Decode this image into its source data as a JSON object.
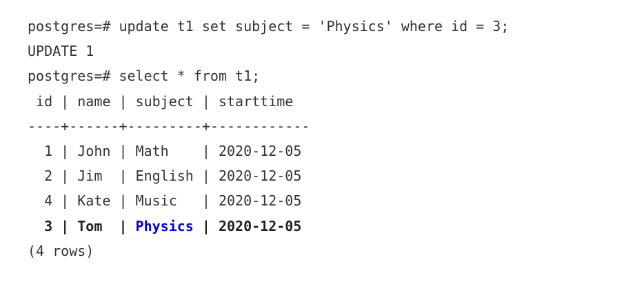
{
  "terminal": {
    "cmd1": "postgres=# update t1 set subject = 'Physics' where id = 3;",
    "result1": "UPDATE 1",
    "cmd2": "postgres=# select * from t1;",
    "header": " id | name | subject | starttime",
    "separator": "----+------+---------+------------",
    "rows": [
      "  1 | John | Math    | 2020-12-05",
      "  2 | Jim  | English | 2020-12-05",
      "  4 | Kate | Music   | 2020-12-05"
    ],
    "updated_row": {
      "prefix": "  3 | Tom  | ",
      "subject": "Physics",
      "suffix": " | 2020-12-05"
    },
    "footer": "(4 rows)"
  },
  "colors": {
    "highlight": "#0000ee"
  }
}
